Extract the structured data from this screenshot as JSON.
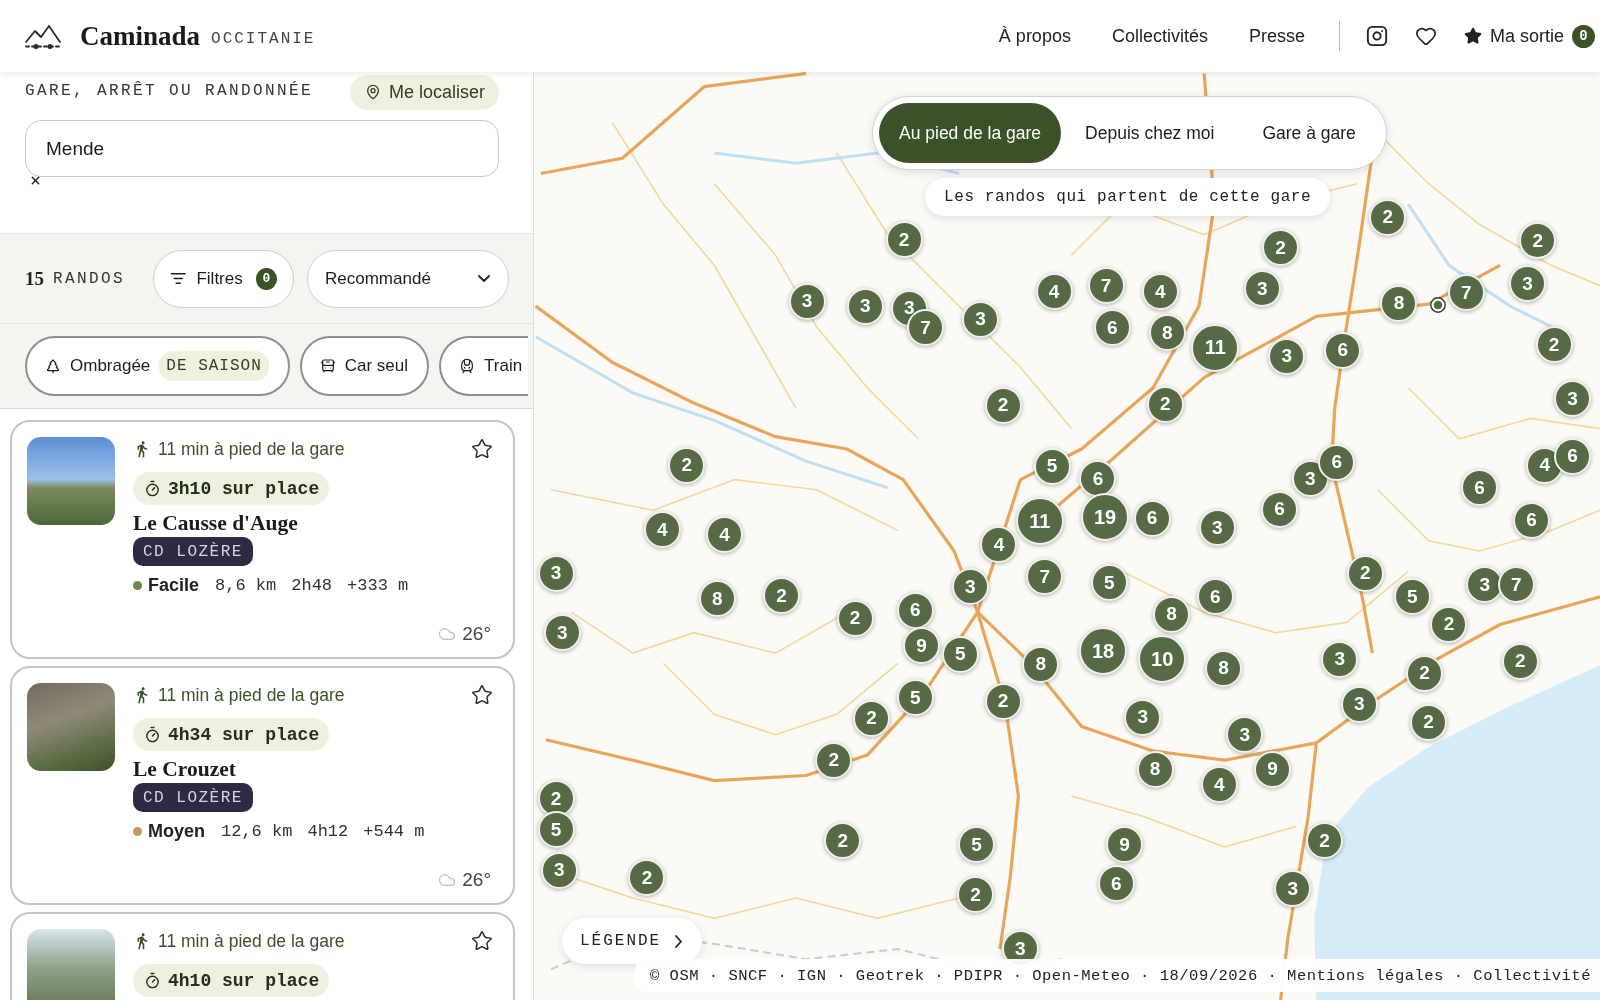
{
  "header": {
    "brand": "Caminada",
    "region": "OCCITANIE",
    "nav": [
      "À propos",
      "Collectivités",
      "Presse"
    ],
    "trip": {
      "label": "Ma sortie",
      "count": "0"
    }
  },
  "search": {
    "label": "GARE, ARRÊT OU RANDONNÉE",
    "locate_button": "Me localiser",
    "value": "Mende"
  },
  "results": {
    "count": "15",
    "unit": "RANDOS",
    "filters": {
      "label": "Filtres",
      "count": "0"
    },
    "sort": "Recommandé"
  },
  "chips": [
    {
      "label": "Ombragée",
      "tag": "DE SAISON",
      "selected": false
    },
    {
      "label": "Car seul",
      "selected": false
    },
    {
      "label": "Train",
      "selected": false
    }
  ],
  "hikes": [
    {
      "access": "11 min à pied de la gare",
      "duration": "3h10 sur place",
      "title": "Le Causse d'Auge",
      "source": "CD LOZÈRE",
      "difficulty": {
        "label": "Facile",
        "color": "#6a8a45"
      },
      "distance": "8,6 km",
      "time": "2h48",
      "elevation": "+333 m",
      "weather": "26°",
      "favorite": false
    },
    {
      "access": "11 min à pied de la gare",
      "duration": "4h34 sur place",
      "title": "Le Crouzet",
      "source": "CD LOZÈRE",
      "difficulty": {
        "label": "Moyen",
        "color": "#c49a5a"
      },
      "distance": "12,6 km",
      "time": "4h12",
      "elevation": "+544 m",
      "weather": "26°",
      "favorite": false
    },
    {
      "access": "11 min à pied de la gare",
      "duration": "4h10 sur place",
      "favorite": false
    }
  ],
  "map": {
    "modes": [
      {
        "label": "Au pied de la gare",
        "selected": true
      },
      {
        "label": "Depuis chez moi",
        "selected": false
      },
      {
        "label": "Gare à gare",
        "selected": false
      }
    ],
    "mode_hint": "Les randos qui partent de cette gare",
    "clusters": [
      "2",
      "2",
      "2",
      "2",
      "3",
      "3",
      "3",
      "4",
      "7",
      "4",
      "3",
      "8",
      "7",
      "3",
      "7",
      "3",
      "6",
      "8",
      "11",
      "3",
      "6",
      "2",
      "2",
      "2",
      "3",
      "2",
      "5",
      "6",
      "3",
      "6",
      "6",
      "4",
      "6",
      "4",
      "4",
      "4",
      "11",
      "19",
      "6",
      "3",
      "6",
      "6",
      "3",
      "8",
      "2",
      "3",
      "7",
      "5",
      "6",
      "2",
      "5",
      "3",
      "7",
      "3",
      "2",
      "6",
      "8",
      "2",
      "9",
      "5",
      "8",
      "18",
      "10",
      "8",
      "3",
      "2",
      "2",
      "2",
      "5",
      "2",
      "3",
      "3",
      "3",
      "2",
      "2",
      "8",
      "4",
      "9",
      "2",
      "5",
      "2",
      "5",
      "9",
      "2",
      "3",
      "2",
      "2",
      "6",
      "3",
      "3"
    ],
    "legend_button": "LÉGENDE",
    "attribution": "© OSM · SNCF · IGN · Geotrek · PDIPR · Open-Meteo · 18/09/2026 · Mentions légales · Collectivité"
  }
}
